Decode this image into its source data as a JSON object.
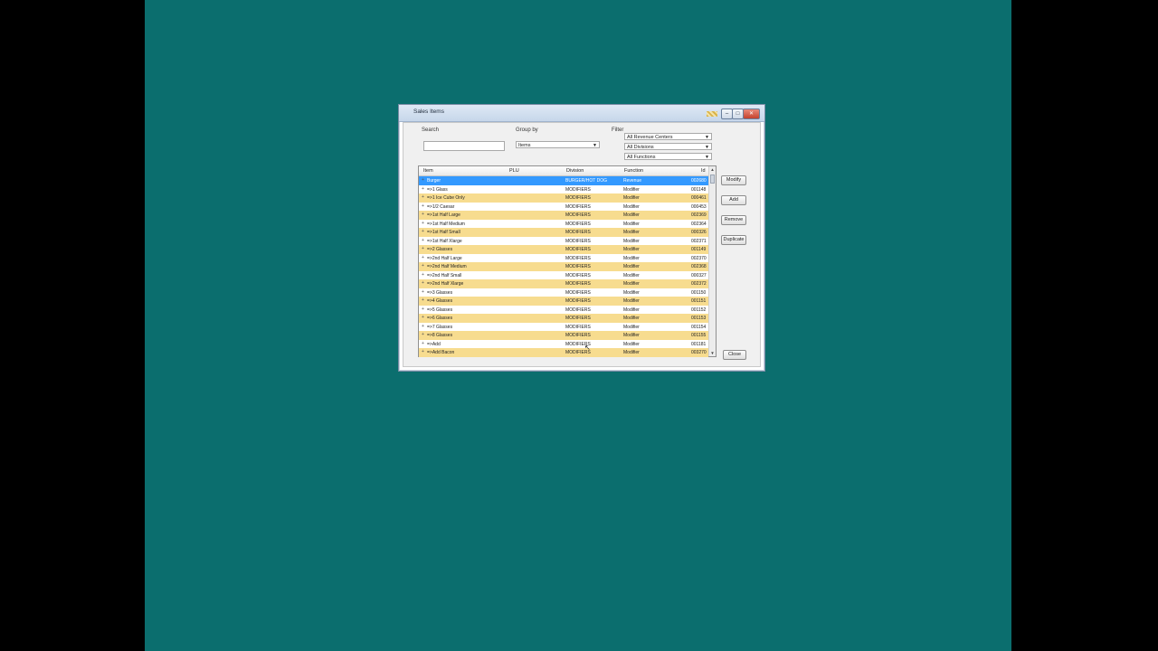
{
  "window": {
    "title": "Sales Items",
    "minimize": "–",
    "maximize": "□",
    "close": "✕"
  },
  "search": {
    "label": "Search",
    "value": "",
    "placeholder": ""
  },
  "group_by": {
    "label": "Group by",
    "selected": "Items"
  },
  "filter": {
    "label": "Filter",
    "revenue_centers": "All Revenue Centers",
    "divisions": "All Divisions",
    "functions": "All Functions"
  },
  "grid": {
    "columns": [
      "Item",
      "PLU",
      "Division",
      "Function",
      "Id"
    ],
    "rows": [
      {
        "item": "Burger",
        "plu": "",
        "division": "BURGER/HOT DOG",
        "function": "Revenue",
        "id": "002680"
      },
      {
        "item": "=>1 Glass",
        "plu": "",
        "division": "MODIFIERS",
        "function": "Modifier",
        "id": "001148"
      },
      {
        "item": "=>1 Ice Cube Only",
        "plu": "",
        "division": "MODIFIERS",
        "function": "Modifier",
        "id": "000461"
      },
      {
        "item": "=>1/2 Caesar",
        "plu": "",
        "division": "MODIFIERS",
        "function": "Modifier",
        "id": "000453"
      },
      {
        "item": "=>1st Half Large",
        "plu": "",
        "division": "MODIFIERS",
        "function": "Modifier",
        "id": "002369"
      },
      {
        "item": "=>1st Half Medium",
        "plu": "",
        "division": "MODIFIERS",
        "function": "Modifier",
        "id": "002364"
      },
      {
        "item": "=>1st Half Small",
        "plu": "",
        "division": "MODIFIERS",
        "function": "Modifier",
        "id": "000326"
      },
      {
        "item": "=>1st Half Xlarge",
        "plu": "",
        "division": "MODIFIERS",
        "function": "Modifier",
        "id": "002371"
      },
      {
        "item": "=>2 Glasses",
        "plu": "",
        "division": "MODIFIERS",
        "function": "Modifier",
        "id": "001149"
      },
      {
        "item": "=>2nd Half Large",
        "plu": "",
        "division": "MODIFIERS",
        "function": "Modifier",
        "id": "002370"
      },
      {
        "item": "=>2nd Half Medium",
        "plu": "",
        "division": "MODIFIERS",
        "function": "Modifier",
        "id": "002368"
      },
      {
        "item": "=>2nd Half Small",
        "plu": "",
        "division": "MODIFIERS",
        "function": "Modifier",
        "id": "000327"
      },
      {
        "item": "=>2nd Half Xlarge",
        "plu": "",
        "division": "MODIFIERS",
        "function": "Modifier",
        "id": "002372"
      },
      {
        "item": "=>3 Glasses",
        "plu": "",
        "division": "MODIFIERS",
        "function": "Modifier",
        "id": "001150"
      },
      {
        "item": "=>4 Glasses",
        "plu": "",
        "division": "MODIFIERS",
        "function": "Modifier",
        "id": "001151"
      },
      {
        "item": "=>5 Glasses",
        "plu": "",
        "division": "MODIFIERS",
        "function": "Modifier",
        "id": "001152"
      },
      {
        "item": "=>6 Glasses",
        "plu": "",
        "division": "MODIFIERS",
        "function": "Modifier",
        "id": "001153"
      },
      {
        "item": "=>7 Glasses",
        "plu": "",
        "division": "MODIFIERS",
        "function": "Modifier",
        "id": "001154"
      },
      {
        "item": "=>8 Glasses",
        "plu": "",
        "division": "MODIFIERS",
        "function": "Modifier",
        "id": "001155"
      },
      {
        "item": "=>Add",
        "plu": "",
        "division": "MODIFIERS",
        "function": "Modifier",
        "id": "001181"
      },
      {
        "item": "=>Add Bacon",
        "plu": "",
        "division": "MODIFIERS",
        "function": "Modifier",
        "id": "003270"
      }
    ]
  },
  "buttons": {
    "modify": "Modify",
    "add": "Add",
    "remove": "Remove",
    "duplicate": "Duplicate",
    "close": "Close"
  },
  "colors": {
    "desktop": "#0b6e6e",
    "row_alt": "#f7dc8f",
    "row_selected": "#3399ff"
  }
}
